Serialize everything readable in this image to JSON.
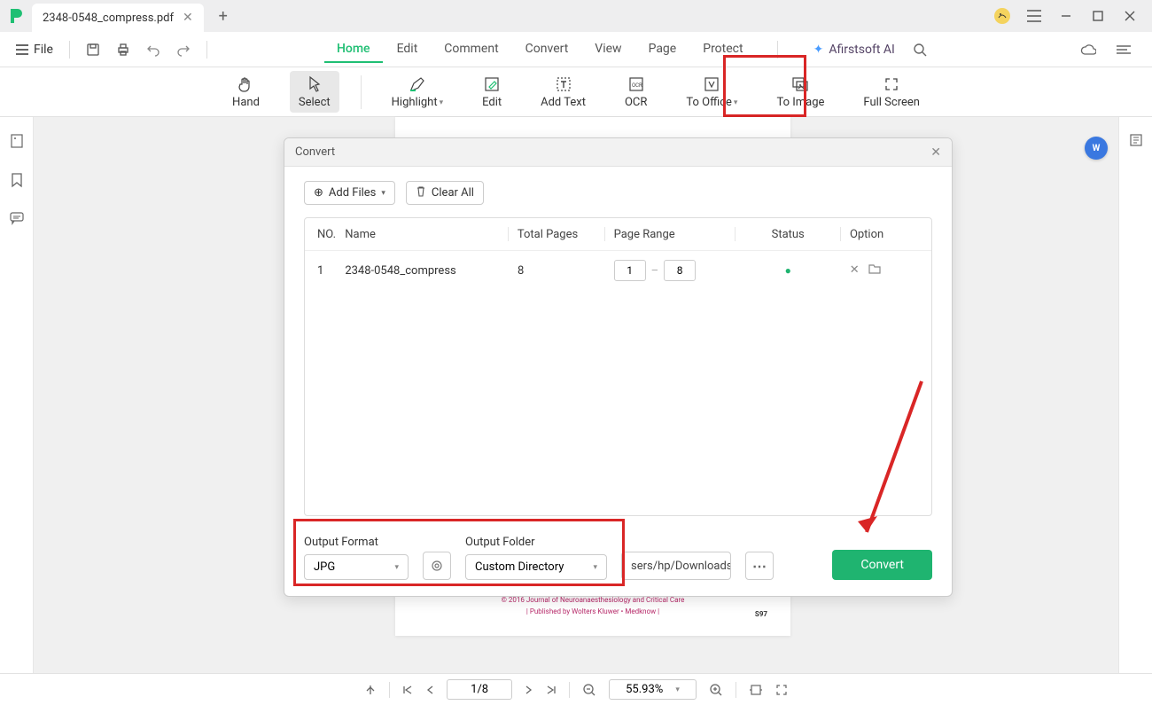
{
  "tab": {
    "title": "2348-0548_compress.pdf"
  },
  "file_label": "File",
  "menu": {
    "home": "Home",
    "edit": "Edit",
    "comment": "Comment",
    "convert": "Convert",
    "view": "View",
    "page": "Page",
    "protect": "Protect"
  },
  "ai_label": "Afirstsoft AI",
  "ribbon": {
    "hand": "Hand",
    "select": "Select",
    "highlight": "Highlight",
    "edit": "Edit",
    "addtext": "Add Text",
    "ocr": "OCR",
    "tooffice": "To Office",
    "toimage": "To Image",
    "fullscreen": "Full Screen"
  },
  "dialog": {
    "title": "Convert",
    "add_files": "Add Files",
    "clear_all": "Clear All",
    "cols": {
      "no": "NO.",
      "name": "Name",
      "total": "Total Pages",
      "range": "Page Range",
      "status": "Status",
      "option": "Option"
    },
    "row": {
      "no": "1",
      "name": "2348-0548_compress",
      "total": "8",
      "from": "1",
      "to": "8"
    },
    "output_format_label": "Output Format",
    "output_format_value": "JPG",
    "output_folder_label": "Output Folder",
    "output_folder_value": "Custom Directory",
    "path": "sers/hp/Downloads/",
    "convert_btn": "Convert"
  },
  "doc": {
    "credit1": "© 2016 Journal of Neuroanaesthesiology and Critical Care",
    "credit2": "| Published by Wolters Kluwer • Medknow |",
    "pagenum": "S97"
  },
  "bottom": {
    "page": "1/8",
    "zoom": "55.93%"
  }
}
